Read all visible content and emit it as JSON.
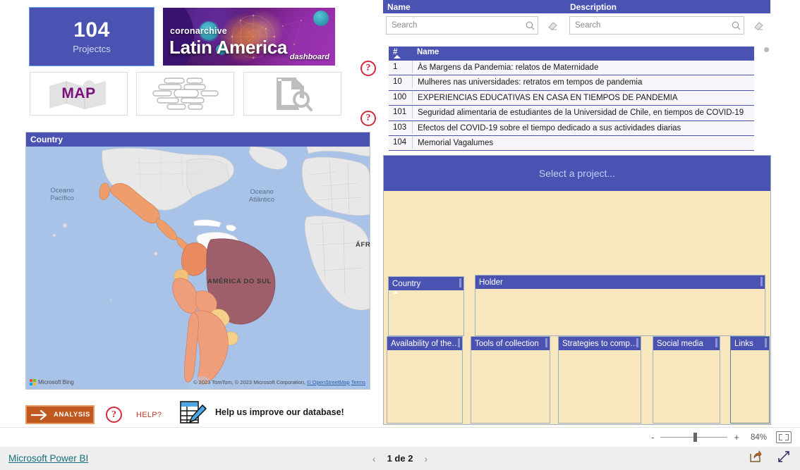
{
  "kpi": {
    "value": "104",
    "label": "Projectcs"
  },
  "banner": {
    "brand": "coronarchive",
    "title": "Latin America",
    "subtitle": "dashboard"
  },
  "nav_buttons": [
    {
      "name": "map-button",
      "label": "MAP",
      "icon": "map-icon"
    },
    {
      "name": "database-button",
      "label": "",
      "icon": "database-stack-icon"
    },
    {
      "name": "document-search-button",
      "label": "",
      "icon": "document-search-icon"
    }
  ],
  "help_icons": {
    "top": "?",
    "bottom": "?",
    "analysis": "?"
  },
  "map": {
    "header": "Country",
    "labels": {
      "pacific": "Oceano\nPacífico",
      "atlantic": "Oceano\nAtlântico",
      "south_america": "AMÉRICA DO SUL",
      "africa": "ÁFR"
    },
    "credit": "Microsoft Bing",
    "attribution": "© 2023 TomTom, © 2023 Microsoft Corporation,",
    "attribution_link": "© OpenStreetMap",
    "terms": "Terms",
    "country_colors": {
      "brazil": "#9e5f6b",
      "mexico": "#ef9e6b",
      "colombia": "#e98a5f",
      "chile_argentina": "#ef9e7c",
      "uruguay_paraguay": "#f5d08a",
      "ecuador": "#f2c27c"
    }
  },
  "actions": {
    "analysis_label": "ANALYSIS",
    "analysis_arrow": "→",
    "help_label": "HELP?",
    "improve_label": "Help us improve our database!"
  },
  "slicers": [
    {
      "header": "Name",
      "placeholder": "Search",
      "value": "",
      "search_icon": "search-icon",
      "clear_icon": "eraser-icon"
    },
    {
      "header": "Description",
      "placeholder": "Search",
      "value": "",
      "search_icon": "search-icon",
      "clear_icon": "eraser-icon"
    }
  ],
  "table": {
    "columns": [
      "#",
      "Name"
    ],
    "sort_column": "#",
    "sort_direction": "ascending",
    "rows": [
      {
        "num": "1",
        "name": "Às Margens da Pandemia: relatos de Maternidade"
      },
      {
        "num": "10",
        "name": "Mulheres nas universidades: retratos em tempos de pandemia"
      },
      {
        "num": "100",
        "name": "EXPERIENCIAS EDUCATIVAS EN CASA EN TIEMPOS DE PANDEMIA"
      },
      {
        "num": "101",
        "name": "Seguridad alimentaria de estudiantes de la Universidad de Chile, en tiempos de COVID-19"
      },
      {
        "num": "103",
        "name": "Efectos del COVID-19 sobre el tiempo dedicado a sus actividades diarias"
      },
      {
        "num": "104",
        "name": "Memorial Vagalumes"
      }
    ]
  },
  "detail": {
    "title": "Select a project...",
    "fields": [
      {
        "name": "country-field",
        "label": "Country",
        "value": "",
        "sorted": true
      },
      {
        "name": "holder-field",
        "label": "Holder",
        "value": ""
      },
      {
        "name": "availability-field",
        "label": "Availability of the…",
        "value": ""
      },
      {
        "name": "tools-field",
        "label": "Tools of collection",
        "value": ""
      },
      {
        "name": "strategies-field",
        "label": "Strategies to comp…",
        "value": ""
      },
      {
        "name": "social-media-field",
        "label": "Social media",
        "value": ""
      },
      {
        "name": "links-field",
        "label": "Links",
        "value": ""
      }
    ]
  },
  "statusbar": {
    "zoom_minus": "-",
    "zoom_plus": "+",
    "zoom_percent": "84%",
    "fit_to_page": "fit-to-page-icon"
  },
  "footer": {
    "brand_link": "Microsoft Power BI",
    "prev_arrow": "‹",
    "page_label": "1 de 2",
    "next_arrow": "›",
    "share_icon": "share-icon",
    "fullscreen_icon": "fullscreen-icon"
  },
  "colors": {
    "accent_purple": "#4a52b2",
    "panel_cream": "#f8e6bc",
    "analysis_orange": "#c0591f",
    "help_red": "#d42a3a",
    "link_teal": "#15707a"
  }
}
